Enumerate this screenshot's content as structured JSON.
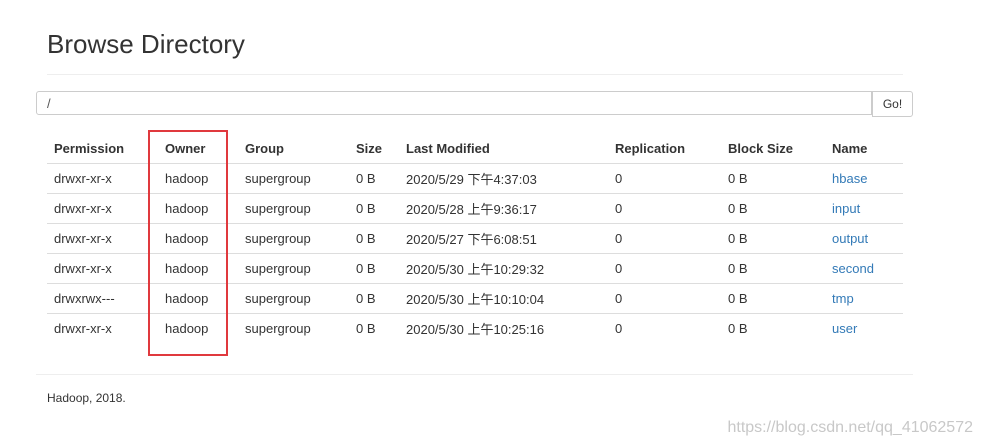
{
  "page": {
    "title": "Browse Directory"
  },
  "path_bar": {
    "value": "/",
    "go_label": "Go!"
  },
  "table": {
    "headers": [
      "Permission",
      "Owner",
      "Group",
      "Size",
      "Last Modified",
      "Replication",
      "Block Size",
      "Name"
    ],
    "rows": [
      {
        "permission": "drwxr-xr-x",
        "owner": "hadoop",
        "group": "supergroup",
        "size": "0 B",
        "modified": "2020/5/29 下午4:37:03",
        "replication": "0",
        "block_size": "0 B",
        "name": "hbase"
      },
      {
        "permission": "drwxr-xr-x",
        "owner": "hadoop",
        "group": "supergroup",
        "size": "0 B",
        "modified": "2020/5/28 上午9:36:17",
        "replication": "0",
        "block_size": "0 B",
        "name": "input"
      },
      {
        "permission": "drwxr-xr-x",
        "owner": "hadoop",
        "group": "supergroup",
        "size": "0 B",
        "modified": "2020/5/27 下午6:08:51",
        "replication": "0",
        "block_size": "0 B",
        "name": "output"
      },
      {
        "permission": "drwxr-xr-x",
        "owner": "hadoop",
        "group": "supergroup",
        "size": "0 B",
        "modified": "2020/5/30 上午10:29:32",
        "replication": "0",
        "block_size": "0 B",
        "name": "second"
      },
      {
        "permission": "drwxrwx---",
        "owner": "hadoop",
        "group": "supergroup",
        "size": "0 B",
        "modified": "2020/5/30 上午10:10:04",
        "replication": "0",
        "block_size": "0 B",
        "name": "tmp"
      },
      {
        "permission": "drwxr-xr-x",
        "owner": "hadoop",
        "group": "supergroup",
        "size": "0 B",
        "modified": "2020/5/30 上午10:25:16",
        "replication": "0",
        "block_size": "0 B",
        "name": "user"
      }
    ]
  },
  "footer": {
    "text": "Hadoop, 2018."
  },
  "watermark": {
    "text": "https://blog.csdn.net/qq_41062572"
  },
  "colors": {
    "link": "#337ab7",
    "highlight_border": "#e0393e",
    "text": "#333333",
    "rule": "#dddddd"
  }
}
